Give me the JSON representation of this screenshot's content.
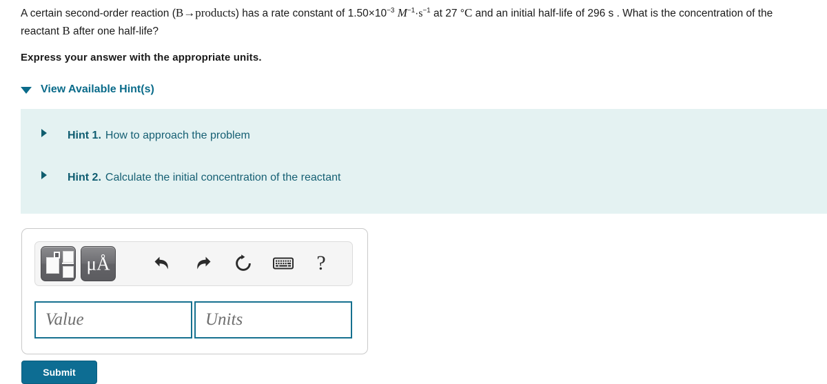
{
  "question": {
    "text_part1": "A certain second-order reaction (",
    "reactant_formula": "B→products",
    "text_part2": ") has a rate constant of 1.50×10",
    "rate_exponent": "−3",
    "unit_molarity": "M",
    "unit_molarity_exp": "−1",
    "unit_dot": "·",
    "unit_seconds": "s",
    "unit_seconds_exp": "−1",
    "text_part3": " at 27",
    "degree_symbol": "°",
    "celsius": "C",
    "text_part4": " and an initial half-life of 296 s . What is the concentration of the reactant ",
    "reactant_symbol": "B",
    "text_part5": " after one half-life?"
  },
  "prompt": {
    "express_instruction": "Express your answer with the appropriate units."
  },
  "hints_toggle": {
    "label": "View Available Hint(s)",
    "caret_icon": "caret-down-icon"
  },
  "hints": {
    "items": [
      {
        "label": "Hint 1.",
        "text": "How to approach the problem",
        "caret_icon": "caret-right-icon"
      },
      {
        "label": "Hint 2.",
        "text": "Calculate the initial concentration of the reactant",
        "caret_icon": "caret-right-icon"
      }
    ]
  },
  "answer": {
    "toolbar": {
      "template_button": {
        "name": "template-button",
        "icon": "math-template-icon"
      },
      "unit_button": {
        "name": "unit-button",
        "label": "μÅ",
        "icon": "greek-units-icon"
      },
      "undo": {
        "name": "undo-button",
        "icon": "undo-arrow-icon"
      },
      "redo": {
        "name": "redo-button",
        "icon": "redo-arrow-icon"
      },
      "reset": {
        "name": "reset-button",
        "icon": "reset-circular-arrow-icon"
      },
      "keyboard": {
        "name": "keyboard-button",
        "icon": "keyboard-icon"
      },
      "help": {
        "name": "help-button",
        "label": "?",
        "icon": "question-mark-icon"
      }
    },
    "value_field": {
      "placeholder": "Value",
      "value": ""
    },
    "units_field": {
      "placeholder": "Units",
      "value": ""
    }
  },
  "submit": {
    "label": "Submit"
  },
  "colors": {
    "link_teal": "#0a6b8a",
    "hint_panel_bg": "#e4f2f2",
    "hint_text": "#155f73",
    "field_border": "#15708f",
    "submit_bg": "#0d6d93"
  }
}
